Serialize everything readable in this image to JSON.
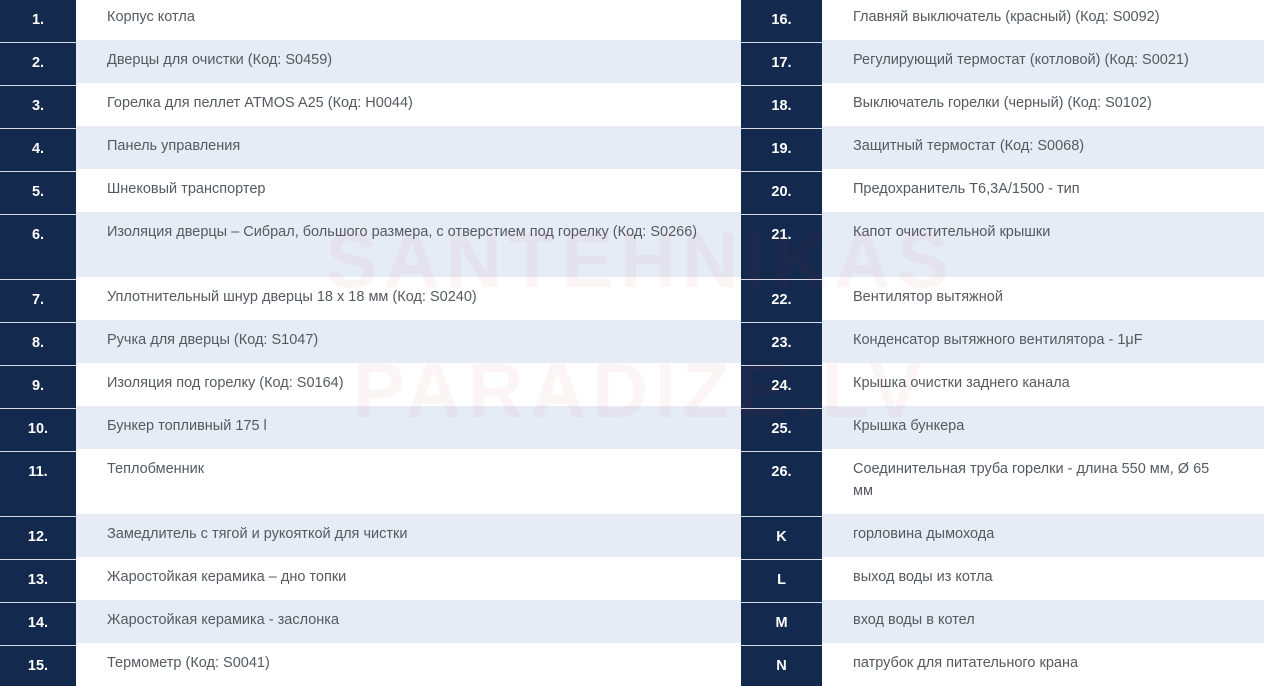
{
  "watermark": {
    "line1": "SANTEHNIKAS",
    "line2": "PARADIZE.LV"
  },
  "rows": [
    {
      "ln": "1.",
      "lt": "Корпус котла",
      "rn": "16.",
      "rt": "Главняй выключатель (красный) (Код: S0092)"
    },
    {
      "ln": "2.",
      "lt": "Дверцы для очистки (Код: S0459)",
      "rn": "17.",
      "rt": "Регулирующий термостат (котловой) (Код: S0021)"
    },
    {
      "ln": "3.",
      "lt": "Горелка для пеллет ATMOS A25 (Код: H0044)",
      "rn": "18.",
      "rt": "Выключатель горелки (черный) (Код: S0102)"
    },
    {
      "ln": "4.",
      "lt": "Панель управления",
      "rn": "19.",
      "rt": "Защитный термостат (Код: S0068)"
    },
    {
      "ln": "5.",
      "lt": "Шнековый транспортер",
      "rn": "20.",
      "rt": "Предохранитель T6,3A/1500 - тип"
    },
    {
      "ln": "6.",
      "lt": "Изоляция дверцы – Сибрал, большого размера, с отверстием под горелку (Код: S0266)",
      "rn": "21.",
      "rt": "Капот очистительной крышки"
    },
    {
      "ln": "7.",
      "lt": "Уплотнительный шнур дверцы 18 x 18 мм (Код: S0240)",
      "rn": "22.",
      "rt": "Вентилятор вытяжной"
    },
    {
      "ln": "8.",
      "lt": "Ручка для дверцы (Код: S1047)",
      "rn": "23.",
      "rt": "Конденсатор вытяжного вентилятора - 1μF"
    },
    {
      "ln": "9.",
      "lt": "Изоляция под горелку (Код: S0164)",
      "rn": "24.",
      "rt": "Крышка очистки заднего канала"
    },
    {
      "ln": "10.",
      "lt": "Бункер топливный 175 l",
      "rn": "25.",
      "rt": "Крышка бункера"
    },
    {
      "ln": "11.",
      "lt": "Теплобменник",
      "rn": "26.",
      "rt": "Соединительная труба горелки - длина 550 мм, Ø 65 мм"
    },
    {
      "ln": "12.",
      "lt": "Замедлитель с тягой и рукояткой для чистки",
      "rn": "K",
      "rt": "горловина дымохода"
    },
    {
      "ln": "13.",
      "lt": "Жаростойкая керамика – дно топки",
      "rn": "L",
      "rt": "выход воды из котла"
    },
    {
      "ln": "14.",
      "lt": "Жаростойкая керамика - заслонка",
      "rn": "M",
      "rt": "вход воды в котел"
    },
    {
      "ln": "15.",
      "lt": "Термометр (Код: S0041)",
      "rn": "N",
      "rt": "патрубок для питательного крана"
    }
  ]
}
